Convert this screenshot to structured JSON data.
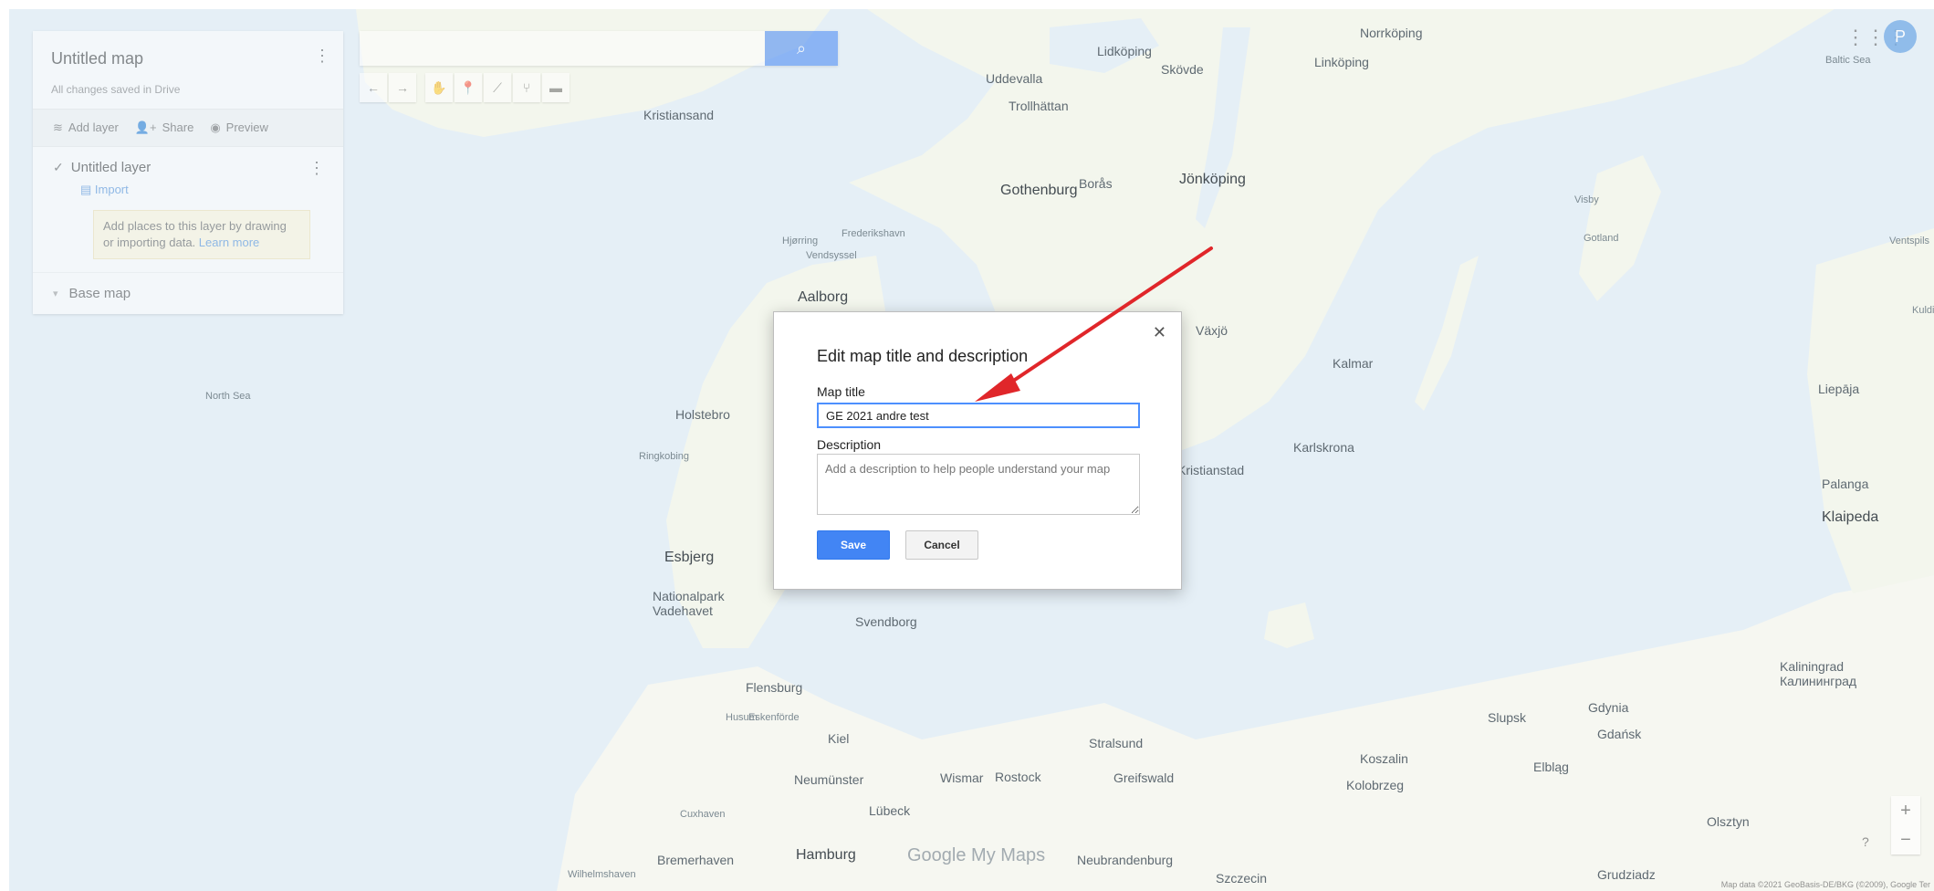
{
  "header": {
    "map_title": "Untitled map",
    "save_status": "All changes saved in Drive",
    "account_initial": "P"
  },
  "panel": {
    "actions": [
      {
        "label": "Add layer",
        "icon": "add-layer-icon"
      },
      {
        "label": "Share",
        "icon": "add-person-icon"
      },
      {
        "label": "Preview",
        "icon": "eye-icon"
      }
    ],
    "layer_name": "Untitled layer",
    "import_label": "Import",
    "hint_text": "Add places to this layer by drawing or importing data.",
    "hint_link": "Learn more",
    "base_map_label": "Base map"
  },
  "search": {
    "placeholder": ""
  },
  "map_labels": [
    {
      "text": "Kristiansand",
      "cls": ""
    },
    {
      "text": "Gothenburg",
      "cls": "big"
    },
    {
      "text": "Jönköping",
      "cls": "big"
    },
    {
      "text": "Linköping",
      "cls": ""
    },
    {
      "text": "Norrköping",
      "cls": ""
    },
    {
      "text": "Aalborg",
      "cls": "big"
    },
    {
      "text": "Växjö",
      "cls": ""
    },
    {
      "text": "Kalmar",
      "cls": ""
    },
    {
      "text": "Karlskrona",
      "cls": ""
    },
    {
      "text": "Kristianstad",
      "cls": ""
    },
    {
      "text": "Esbjerg",
      "cls": "big"
    },
    {
      "text": "Flensburg",
      "cls": ""
    },
    {
      "text": "Kiel",
      "cls": ""
    },
    {
      "text": "Rostock",
      "cls": ""
    },
    {
      "text": "Lübeck",
      "cls": ""
    },
    {
      "text": "Hamburg",
      "cls": "big"
    },
    {
      "text": "Bremerhaven",
      "cls": ""
    },
    {
      "text": "Szczecin",
      "cls": ""
    },
    {
      "text": "Koszalin",
      "cls": ""
    },
    {
      "text": "Slupsk",
      "cls": ""
    },
    {
      "text": "Gdynia",
      "cls": ""
    },
    {
      "text": "Gdańsk",
      "cls": ""
    },
    {
      "text": "Elbląg",
      "cls": ""
    },
    {
      "text": "Olsztyn",
      "cls": ""
    },
    {
      "text": "Kaliningrad\nКалининград",
      "cls": ""
    },
    {
      "text": "Klaipeda",
      "cls": "big"
    },
    {
      "text": "Liepāja",
      "cls": ""
    },
    {
      "text": "Palanga",
      "cls": ""
    },
    {
      "text": "Gotland",
      "cls": "small"
    },
    {
      "text": "Visby",
      "cls": "small"
    },
    {
      "text": "Holstebro",
      "cls": ""
    },
    {
      "text": "Ringkobing",
      "cls": "small"
    },
    {
      "text": "Svendborg",
      "cls": ""
    },
    {
      "text": "Nationalpark\nVadehavet",
      "cls": ""
    },
    {
      "text": "Neumünster",
      "cls": ""
    },
    {
      "text": "Cuxhaven",
      "cls": "small"
    },
    {
      "text": "Wilhelmshaven",
      "cls": "small"
    },
    {
      "text": "North Sea",
      "cls": "small"
    },
    {
      "text": "Baltic Sea",
      "cls": "small"
    },
    {
      "text": "Trollhättan",
      "cls": ""
    },
    {
      "text": "Borås",
      "cls": ""
    },
    {
      "text": "Uddevalla",
      "cls": ""
    },
    {
      "text": "Skövde",
      "cls": ""
    },
    {
      "text": "Lidköping",
      "cls": ""
    },
    {
      "text": "Grudziadz",
      "cls": ""
    },
    {
      "text": "Kolobrzeg",
      "cls": ""
    },
    {
      "text": "Neubrandenburg",
      "cls": ""
    },
    {
      "text": "Stralsund",
      "cls": ""
    },
    {
      "text": "Greifswald",
      "cls": ""
    },
    {
      "text": "Wismar",
      "cls": ""
    },
    {
      "text": "Eskenförde",
      "cls": "small"
    },
    {
      "text": "Husum",
      "cls": "small"
    },
    {
      "text": "Vendsyssel",
      "cls": "small"
    },
    {
      "text": "Hjørring",
      "cls": "small"
    },
    {
      "text": "Frederikshavn",
      "cls": "small"
    },
    {
      "text": "Ventspils",
      "cls": "small"
    },
    {
      "text": "Kuldi",
      "cls": "small"
    }
  ],
  "footer": {
    "logo": "Google My Maps",
    "attribution": "Map data ©2021 GeoBasis-DE/BKG (©2009), Google   Ter",
    "help": "?",
    "zoom_in": "+",
    "zoom_out": "−"
  },
  "dialog": {
    "title": "Edit map title and description",
    "map_title_label": "Map title",
    "map_title_value": "GE 2021 andre test",
    "description_label": "Description",
    "description_placeholder": "Add a description to help people understand your map",
    "save_label": "Save",
    "cancel_label": "Cancel",
    "close_glyph": "✕"
  },
  "colors": {
    "water": "#cfe2ef",
    "land": "#eef1e6",
    "accent": "#4285f4",
    "annotation_arrow": "#e0262a"
  }
}
